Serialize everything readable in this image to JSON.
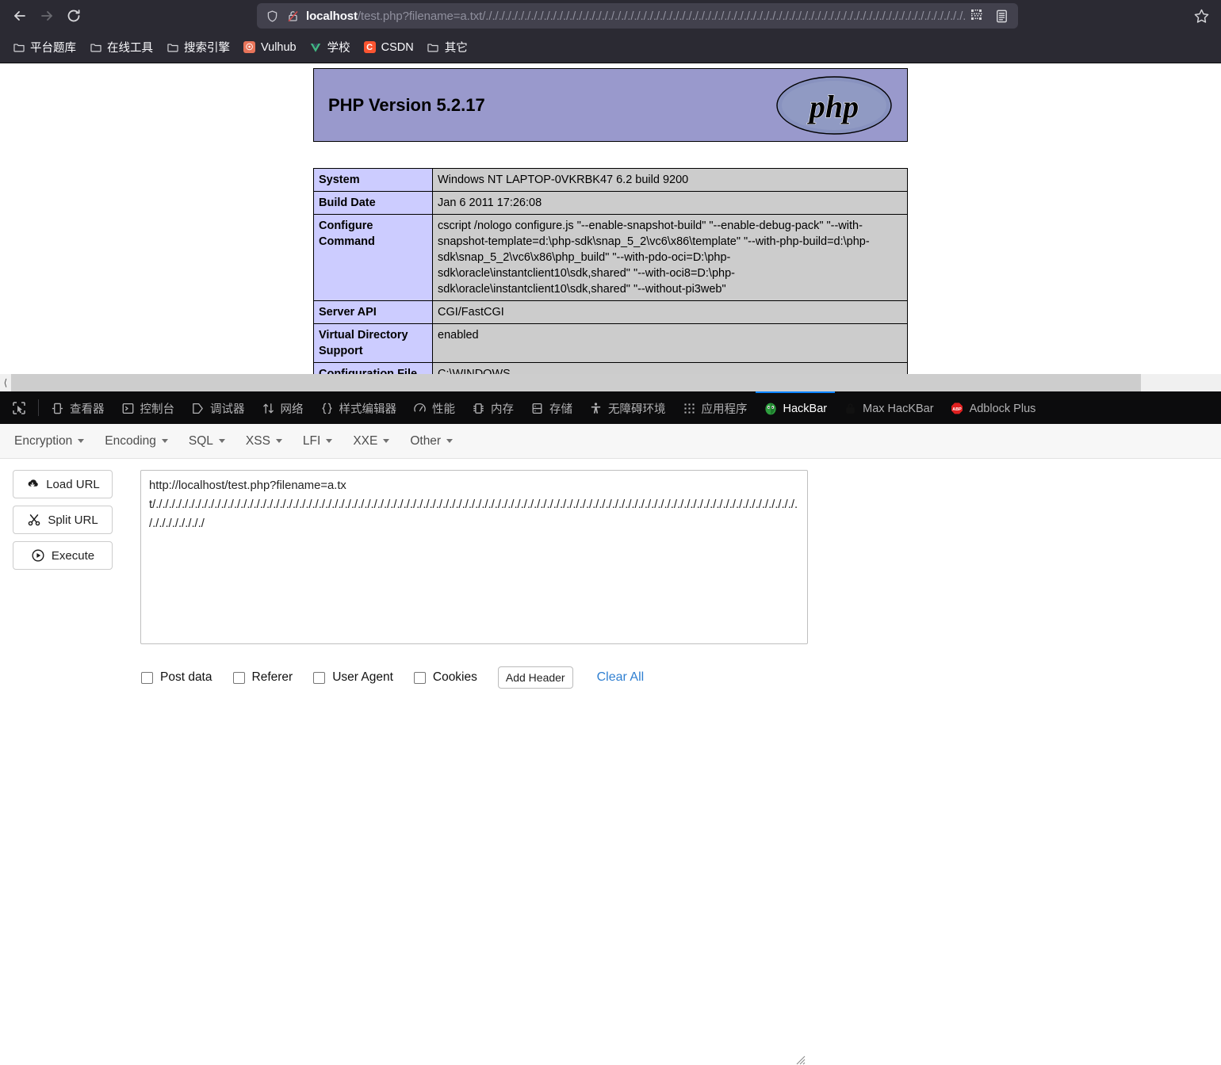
{
  "browser": {
    "nav": {
      "back": "back-arrow",
      "forward": "forward-arrow",
      "reload": "reload"
    },
    "urlbar": {
      "host": "localhost",
      "path": "/test.php?filename=a.txt/./././././././././././././././././././././././././././././././././././././././././././././././././././././././././././././././././././././././././././././././././././././././././././././././././././././././././././././././",
      "shield_icon": "shield-icon",
      "lock_broken_icon": "lock-broken-icon",
      "qr_icon": "qr-code-icon",
      "reader_icon": "reader-mode-icon",
      "bookmark_icon": "bookmark-star-icon"
    },
    "bookmarks": [
      {
        "label": "平台题库",
        "icon": "folder-icon",
        "type": "folder"
      },
      {
        "label": "在线工具",
        "icon": "folder-icon",
        "type": "folder"
      },
      {
        "label": "搜索引擎",
        "icon": "folder-icon",
        "type": "folder"
      },
      {
        "label": "Vulhub",
        "icon": "vulhub-icon",
        "type": "site",
        "color": "#e8745a"
      },
      {
        "label": "学校",
        "icon": "vue-icon",
        "type": "site",
        "color": "#41b883"
      },
      {
        "label": "CSDN",
        "icon": "csdn-icon",
        "type": "site",
        "color": "#fc5531"
      },
      {
        "label": "其它",
        "icon": "folder-icon",
        "type": "folder"
      }
    ]
  },
  "phpinfo": {
    "version_title": "PHP Version 5.2.17",
    "logo_text": "php",
    "header_bg": "#9999cc",
    "key_bg": "#ccccff",
    "value_bg": "#cccccc",
    "rows": [
      {
        "key": "System",
        "value": "Windows NT LAPTOP-0VKRBK47 6.2 build 9200"
      },
      {
        "key": "Build Date",
        "value": "Jan 6 2011 17:26:08"
      },
      {
        "key": "Configure Command",
        "value": "cscript /nologo configure.js \"--enable-snapshot-build\" \"--enable-debug-pack\" \"--with-snapshot-template=d:\\php-sdk\\snap_5_2\\vc6\\x86\\template\" \"--with-php-build=d:\\php-sdk\\snap_5_2\\vc6\\x86\\php_build\" \"--with-pdo-oci=D:\\php-sdk\\oracle\\instantclient10\\sdk,shared\" \"--with-oci8=D:\\php-sdk\\oracle\\instantclient10\\sdk,shared\" \"--without-pi3web\""
      },
      {
        "key": "Server API",
        "value": "CGI/FastCGI"
      },
      {
        "key": "Virtual Directory Support",
        "value": "enabled"
      },
      {
        "key": "Configuration File",
        "value": "C:\\WINDOWS"
      }
    ]
  },
  "devtools": {
    "picker_icon": "element-picker-icon",
    "tabs": [
      {
        "label": "查看器",
        "icon": "inspector-icon",
        "active": false
      },
      {
        "label": "控制台",
        "icon": "console-icon",
        "active": false
      },
      {
        "label": "调试器",
        "icon": "debugger-icon",
        "active": false
      },
      {
        "label": "网络",
        "icon": "network-icon",
        "active": false
      },
      {
        "label": "样式编辑器",
        "icon": "style-editor-icon",
        "active": false
      },
      {
        "label": "性能",
        "icon": "performance-icon",
        "active": false
      },
      {
        "label": "内存",
        "icon": "memory-icon",
        "active": false
      },
      {
        "label": "存储",
        "icon": "storage-icon",
        "active": false
      },
      {
        "label": "无障碍环境",
        "icon": "accessibility-icon",
        "active": false
      },
      {
        "label": "应用程序",
        "icon": "application-icon",
        "active": false
      },
      {
        "label": "HackBar",
        "icon": "hackbar-icon",
        "active": true
      },
      {
        "label": "Max HacKBar",
        "icon": "max-hackbar-icon",
        "active": false
      },
      {
        "label": "Adblock Plus",
        "icon": "adblock-plus-icon",
        "active": false
      }
    ],
    "active_tab_color": "#0a84ff"
  },
  "hackbar": {
    "menus": [
      {
        "label": "Encryption"
      },
      {
        "label": "Encoding"
      },
      {
        "label": "SQL"
      },
      {
        "label": "XSS"
      },
      {
        "label": "LFI"
      },
      {
        "label": "XXE"
      },
      {
        "label": "Other"
      }
    ],
    "buttons": [
      {
        "label": "Load URL",
        "icon": "cloud-download-icon"
      },
      {
        "label": "Split URL",
        "icon": "scissors-icon"
      },
      {
        "label": "Execute",
        "icon": "play-circle-icon"
      }
    ],
    "url_value": "http://localhost/test.php?filename=a.txt/./././././././././././././././././././././././././././././././././././././././././././././././././././././././././././././././././././././././././././././././././././././././././././././././././././././././././././",
    "checkboxes": [
      {
        "label": "Post data",
        "checked": false
      },
      {
        "label": "Referer",
        "checked": false
      },
      {
        "label": "User Agent",
        "checked": false
      },
      {
        "label": "Cookies",
        "checked": false
      }
    ],
    "add_header_label": "Add Header",
    "clear_all_label": "Clear All",
    "clear_all_color": "#2f7fd1"
  }
}
